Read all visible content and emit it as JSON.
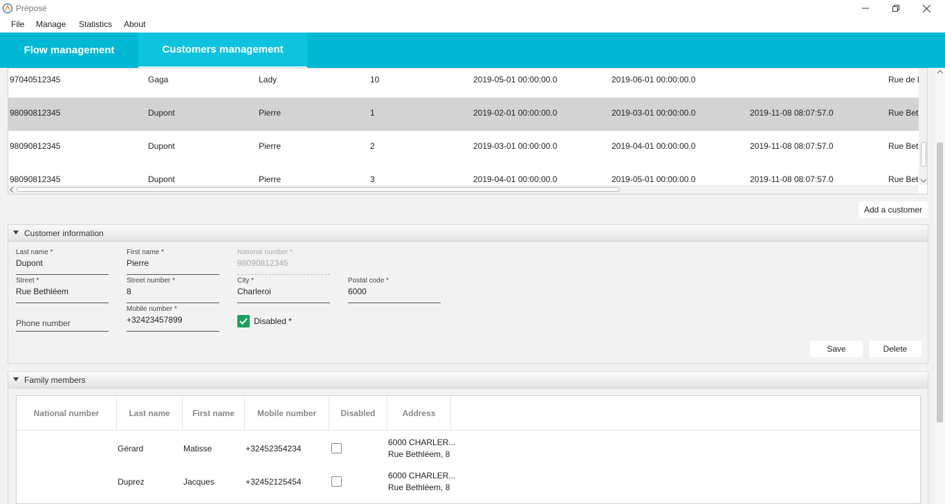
{
  "window": {
    "title": "Préposé"
  },
  "menu": [
    "File",
    "Manage",
    "Statistics",
    "About"
  ],
  "tabs": [
    "Flow management",
    "Customers management"
  ],
  "main_table": {
    "rows": [
      [
        "97040512345",
        "Gaga",
        "Lady",
        "10",
        "2019-05-01 00:00:00.0",
        "2019-06-01 00:00:00.0",
        "",
        "Rue de l"
      ],
      [
        "98090812345",
        "Dupont",
        "Pierre",
        "1",
        "2019-02-01 00:00:00.0",
        "2019-03-01 00:00:00.0",
        "2019-11-08 08:07:57.0",
        "Rue Beth"
      ],
      [
        "98090812345",
        "Dupont",
        "Pierre",
        "2",
        "2019-03-01 00:00:00.0",
        "2019-04-01 00:00:00.0",
        "2019-11-08 08:07:57.0",
        "Rue Beth"
      ],
      [
        "98090812345",
        "Dupont",
        "Pierre",
        "3",
        "2019-04-01 00:00:00.0",
        "2019-05-01 00:00:00.0",
        "2019-11-08 08:07:57.0",
        "Rue Beth"
      ]
    ]
  },
  "add_customer_label": "Add a customer",
  "customer_panel": {
    "title": "Customer information",
    "last_name": {
      "label": "Last name *",
      "value": "Dupont"
    },
    "first_name": {
      "label": "First name *",
      "value": "Pierre"
    },
    "national_number": {
      "label": "National number *",
      "value": "98090812345"
    },
    "street": {
      "label": "Street *",
      "value": "Rue Bethléem"
    },
    "street_number": {
      "label": "Street number *",
      "value": "8"
    },
    "city": {
      "label": "City *",
      "value": "Charleroi"
    },
    "postal_code": {
      "label": "Postal code *",
      "value": "6000"
    },
    "phone": {
      "placeholder": "Phone number"
    },
    "mobile": {
      "label": "Mobile number *",
      "value": "+32423457899"
    },
    "disabled_label": "Disabled *",
    "save_label": "Save",
    "delete_label": "Delete"
  },
  "family_panel": {
    "title": "Family members",
    "columns": [
      "National number",
      "Last name",
      "First name",
      "Mobile number",
      "Disabled",
      "Address"
    ],
    "rows": [
      {
        "national": "",
        "last": "Gérard",
        "first": "Matisse",
        "mobile": "+32452354234",
        "address1": "6000 CHARLER...",
        "address2": "Rue Bethléem, 8"
      },
      {
        "national": "",
        "last": "Duprez",
        "first": "Jacques",
        "mobile": "+32452125454",
        "address1": "6000 CHARLER...",
        "address2": "Rue Bethléem, 8"
      }
    ]
  },
  "colors": {
    "tab_bar": "#00b8d4",
    "checkbox_checked": "#1aa15e",
    "selected_row": "#d3d3d3"
  }
}
